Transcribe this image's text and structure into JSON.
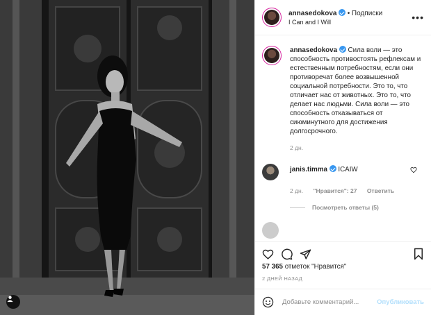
{
  "header": {
    "username": "annasedokova",
    "separator": "•",
    "follow_label": "Подписки",
    "location": "I Can and I Will",
    "more_label": "•••"
  },
  "caption": {
    "username": "annasedokova",
    "text": "Сила воли — это способность противостоять рефлексам и естественным потребностям, если они противоречат более возвышенной социальной потребности. Это то, что отличает нас от животных. Это то, что делает нас людьми. Сила воли — это способность отказываться от сиюминутного для достижения долгосрочного.",
    "age": "2 дн."
  },
  "comment": {
    "username": "janis.timma",
    "text": "ICAIW",
    "age": "2 дн.",
    "likes": "\"Нравится\": 27",
    "reply_label": "Ответить",
    "view_replies": "Посмотреть ответы (5)"
  },
  "actions": {
    "likes_count": "57 365",
    "likes_label": "отметок \"Нравится\"",
    "date": "2 ДНЕЙ НАЗАД"
  },
  "add_comment": {
    "placeholder": "Добавьте комментарий...",
    "post_label": "Опубликовать"
  },
  "icons": [
    "like-icon",
    "comment-icon",
    "share-icon",
    "save-icon",
    "emoji-icon",
    "user-tag-icon",
    "more-icon",
    "verified-icon"
  ]
}
